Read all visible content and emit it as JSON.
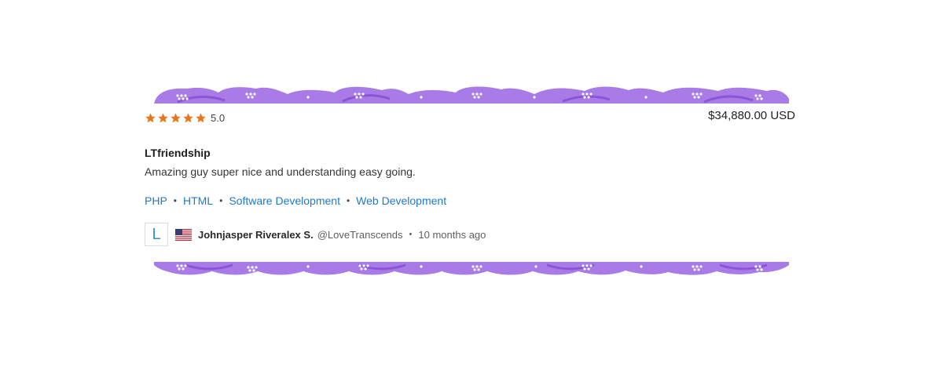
{
  "review": {
    "rating": 5,
    "rating_label": "5.0",
    "price": "$34,880.00 USD",
    "title": "LTfriendship",
    "comment": "Amazing guy super nice and understanding easy going.",
    "skills": [
      "PHP",
      "HTML",
      "Software Development",
      "Web Development"
    ],
    "reviewer": {
      "avatar_letter": "L",
      "flag": "us-flag-icon",
      "name": "Johnjasper Riveralex S.",
      "username": "@LoveTranscends",
      "time_ago": "10 months ago"
    }
  },
  "colors": {
    "star": "#e7771a",
    "link": "#1f7ac9",
    "border_decoration": "#a97be6"
  }
}
